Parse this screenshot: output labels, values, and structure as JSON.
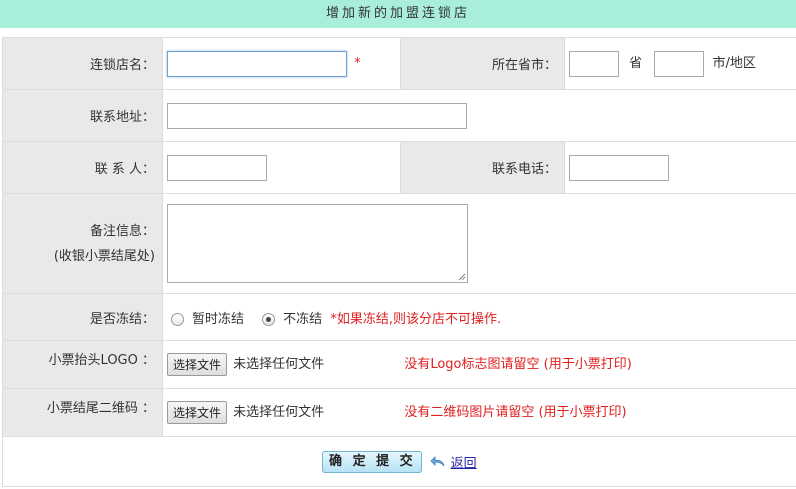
{
  "header": {
    "title": "增加新的加盟连锁店"
  },
  "form": {
    "store_name": {
      "label": "连锁店名：",
      "value": "",
      "required_mark": "*"
    },
    "province": {
      "label": "所在省市：",
      "province_value": "",
      "province_unit": "省",
      "city_value": "",
      "city_unit": "市/地区"
    },
    "address": {
      "label": "联系地址：",
      "value": ""
    },
    "contact": {
      "label": "联 系 人：",
      "value": ""
    },
    "phone": {
      "label": "联系电话：",
      "value": ""
    },
    "remark": {
      "label": "备注信息：",
      "sublabel": "(收银小票结尾处)",
      "value": ""
    },
    "freeze": {
      "label": "是否冻结：",
      "option_temp": "暂时冻结",
      "option_no": "不冻结",
      "selected": "不冻结",
      "note": "*如果冻结,则该分店不可操作."
    },
    "logo": {
      "label": "小票抬头LOGO ：",
      "button": "选择文件",
      "no_file": "未选择任何文件",
      "hint": "没有Logo标志图请留空 (用于小票打印)"
    },
    "qrcode": {
      "label": "小票结尾二维码 ：",
      "button": "选择文件",
      "no_file": "未选择任何文件",
      "hint": "没有二维码图片请留空 (用于小票打印)"
    }
  },
  "actions": {
    "submit_label": "确 定 提 交",
    "back_label": "返回"
  },
  "colors": {
    "header_bg": "#a8eedb",
    "label_bg": "#e9e9e9",
    "warning": "#e02020",
    "link": "#2222aa"
  }
}
